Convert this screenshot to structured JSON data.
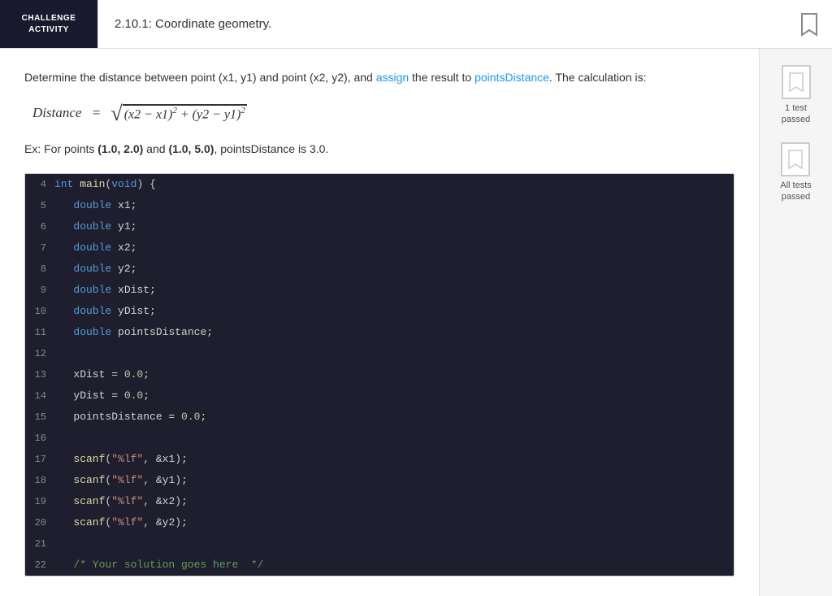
{
  "header": {
    "challenge_label": "CHALLENGE\nACTIVITY",
    "title": "2.10.1: Coordinate geometry.",
    "bookmark_aria": "bookmark"
  },
  "description": {
    "text_before_assign": "Determine the distance between point (x1, y1) and point (x2, y2), and ",
    "assign_word": "assign",
    "text_after_assign": " the result to ",
    "points_word": "pointsDistance",
    "text_end": ". The calculation is:"
  },
  "formula": {
    "label": "Distance",
    "display": "Distance = √((x2 − x1)² + (y2 − y1)²)"
  },
  "example": {
    "text": "Ex: For points (1.0, 2.0) and (1.0, 5.0), pointsDistance is 3.0."
  },
  "code": {
    "lines": [
      {
        "num": 4,
        "content": "int main(void) {"
      },
      {
        "num": 5,
        "content": "   double x1;"
      },
      {
        "num": 6,
        "content": "   double y1;"
      },
      {
        "num": 7,
        "content": "   double x2;"
      },
      {
        "num": 8,
        "content": "   double y2;"
      },
      {
        "num": 9,
        "content": "   double xDist;"
      },
      {
        "num": 10,
        "content": "   double yDist;"
      },
      {
        "num": 11,
        "content": "   double pointsDistance;"
      },
      {
        "num": 12,
        "content": ""
      },
      {
        "num": 13,
        "content": "   xDist = 0.0;"
      },
      {
        "num": 14,
        "content": "   yDist = 0.0;"
      },
      {
        "num": 15,
        "content": "   pointsDistance = 0.0;"
      },
      {
        "num": 16,
        "content": ""
      },
      {
        "num": 17,
        "content": "   scanf(\"%lf\", &x1);"
      },
      {
        "num": 18,
        "content": "   scanf(\"%lf\", &y1);"
      },
      {
        "num": 19,
        "content": "   scanf(\"%lf\", &x2);"
      },
      {
        "num": 20,
        "content": "   scanf(\"%lf\", &y2);"
      },
      {
        "num": 21,
        "content": ""
      },
      {
        "num": 22,
        "content": "   /* Your solution goes here  */"
      }
    ]
  },
  "right_panel": {
    "test1": {
      "label": "1 test\npassed",
      "aria": "1 test passed badge"
    },
    "test2": {
      "label": "All tests\npassed",
      "aria": "All tests passed badge"
    }
  }
}
